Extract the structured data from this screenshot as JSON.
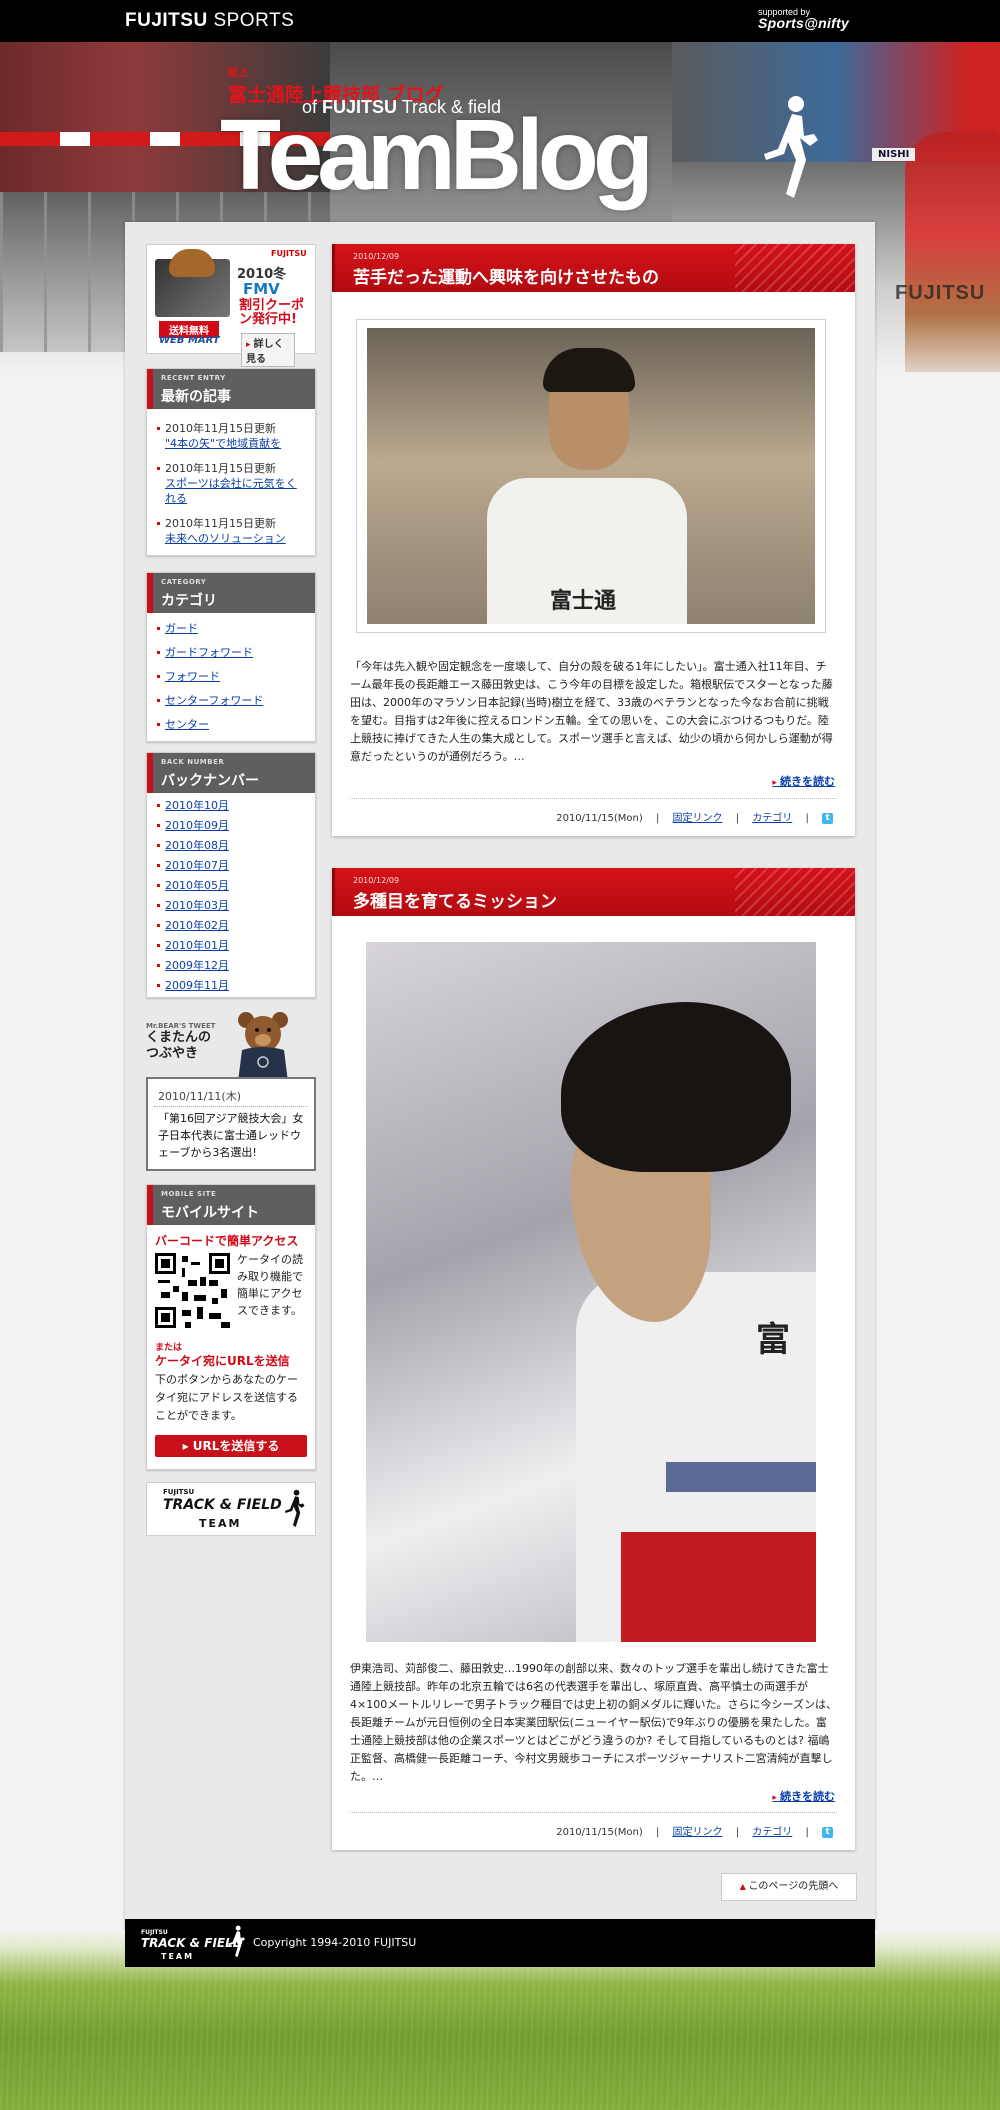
{
  "topbar": {
    "brand_bold": "FUJITSU",
    "brand_rest": " SPORTS",
    "supported_by": "supported by",
    "supported_logo": "Sports@nifty"
  },
  "header": {
    "jp_small": "陸上",
    "jp_title": "富士通陸上競技部 ブログ",
    "en_of": "of ",
    "en_brand": "FUJITSU",
    "en_rest": " Track & field",
    "title": "TeamBlog",
    "board_text": "FUJITSU",
    "banner_text": "NISHI"
  },
  "ad": {
    "brand": "FUJITSU",
    "year": "2010冬",
    "product": "FMV",
    "coupon": "割引クーポン発行中!",
    "free_shipping": "送料無料",
    "store": "WEB MART",
    "more": "詳しく見る"
  },
  "recent": {
    "en": "RECENT ENTRY",
    "jp": "最新の記事",
    "items": [
      {
        "date": "2010年11月15日更新",
        "title": "\"4本の矢\"で地域貢献を"
      },
      {
        "date": "2010年11月15日更新",
        "title": "スポーツは会社に元気をくれる"
      },
      {
        "date": "2010年11月15日更新",
        "title": "未来へのソリューション"
      }
    ]
  },
  "category": {
    "en": "CATEGORY",
    "jp": "カテゴリ",
    "items": [
      "ガード",
      "ガードフォワード",
      "フォワード",
      "センターフォワード",
      "センター"
    ]
  },
  "backnumber": {
    "en": "BACK NUMBER",
    "jp": "バックナンバー",
    "items": [
      "2010年10月",
      "2010年09月",
      "2010年08月",
      "2010年07月",
      "2010年05月",
      "2010年03月",
      "2010年02月",
      "2010年01月",
      "2009年12月",
      "2009年11月"
    ]
  },
  "bear": {
    "en": "Mr.BEAR'S TWEET",
    "jp_line1": "くまたんの",
    "jp_line2": "つぶやき",
    "tweet_date": "2010/11/11(木)",
    "tweet_text": "「第16回アジア競技大会」女子日本代表に富士通レッドウェーブから3名選出!"
  },
  "mobile": {
    "en": "MOBILE SITE",
    "jp": "モバイルサイト",
    "barcode_heading": "バーコードで簡単アクセス",
    "barcode_text": "ケータイの読み取り機能で簡単にアクセスできます。",
    "or": "または",
    "url_heading": "ケータイ宛にURLを送信",
    "url_text": "下のボタンからあなたのケータイ宛にアドレスを送信することができます。",
    "button": "URLを送信する"
  },
  "team_logo": {
    "brand": "FUJITSU",
    "name": "TRACK & FIELD",
    "team": "TEAM"
  },
  "posts": [
    {
      "date": "2010/12/09",
      "title": "苦手だった運動へ興味を向けさせたもの",
      "photo_text": "富士通",
      "body": "「今年は先入観や固定観念を一度壊して、自分の殻を破る1年にしたい」。富士通入社11年目、チーム最年長の長距離エース藤田敦史は、こう今年の目標を設定した。箱根駅伝でスターとなった藤田は、2000年のマラソン日本記録(当時)樹立を経て、33歳のベテランとなった今なお合前に挑戦を望む。目指すは2年後に控えるロンドン五輪。全ての思いを、この大会にぶつけるつもりだ。陸上競技に捧げてきた人生の集大成として。スポーツ選手と言えば、幼少の頃から何かしら運動が得意だったというのが通例だろう。…",
      "more": "続きを読む",
      "meta_date": "2010/11/15(Mon)",
      "permalink": "固定リンク",
      "category": "カテゴリ",
      "twitter": "t"
    },
    {
      "date": "2010/12/09",
      "title": "多種目を育てるミッション",
      "photo_text": "富",
      "body": "伊東浩司、苅部俊二、藤田敦史…1990年の創部以来、数々のトップ選手を輩出し続けてきた富士通陸上競技部。昨年の北京五輪では6名の代表選手を輩出し、塚原直貴、高平慎士の両選手が4×100メートルリレーで男子トラック種目では史上初の銅メダルに輝いた。さらに今シーズンは、長距離チームが元日恒例の全日本実業団駅伝(ニューイヤー駅伝)で9年ぶりの優勝を果たした。富士通陸上競技部は他の企業スポーツとはどこがどう違うのか? そして目指しているものとは? 福嶋正監督、高橋健一長距離コーチ、今村文男競歩コーチにスポーツジャーナリスト二宮清純が直撃した。…",
      "more": "続きを読む",
      "meta_date": "2010/11/15(Mon)",
      "permalink": "固定リンク",
      "category": "カテゴリ",
      "twitter": "t"
    }
  ],
  "pagetop": "このページの先頭へ",
  "footer": {
    "logo_brand": "FUJITSU",
    "logo_name": "TRACK & FIELD",
    "logo_team": "TEAM",
    "copyright": "Copyright 1994-2010 FUJITSU"
  },
  "colors": {
    "accent": "#d10a18",
    "link": "#0b3fa8",
    "panel": "#5f5f5f"
  }
}
